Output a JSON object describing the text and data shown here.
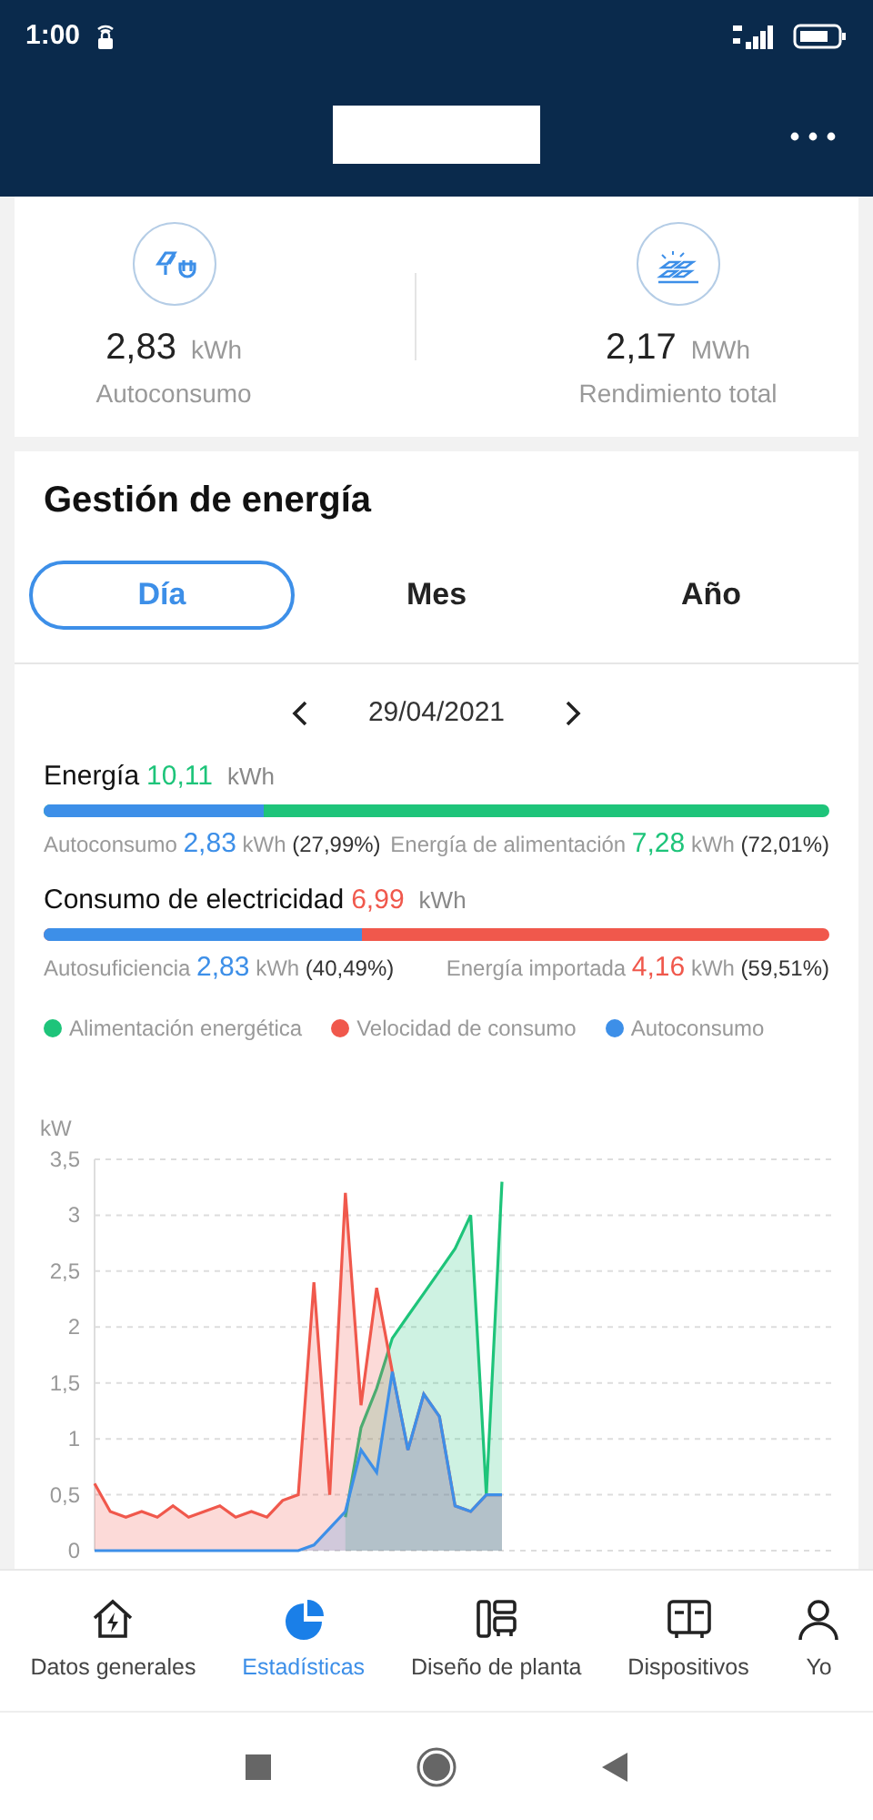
{
  "status_bar": {
    "time": "1:00"
  },
  "summary": [
    {
      "value": "2,83",
      "unit": "kWh",
      "label": "Autoconsumo",
      "kind": "selfuse"
    },
    {
      "value": "2,17",
      "unit": "MWh",
      "label": "Rendimiento total",
      "kind": "yield"
    }
  ],
  "energy_management": {
    "title": "Gestión de energía",
    "tabs": [
      {
        "label": "Día",
        "selected": true
      },
      {
        "label": "Mes",
        "selected": false
      },
      {
        "label": "Año",
        "selected": false
      }
    ],
    "date": "29/04/2021",
    "meters": [
      {
        "title": "Energía",
        "total": "10,11",
        "unit": "kWh",
        "color": "#1ec47a",
        "level": 0.2799,
        "left": {
          "label": "Autoconsumo",
          "value": "2,83",
          "unit": "kWh",
          "percent": "(27,99%)",
          "color": "#3d8fe8"
        },
        "right": {
          "label": "Energía de alimentación",
          "value": "7,28",
          "unit": "kWh",
          "percent": "(72,01%)",
          "color": "#1ec47a"
        }
      },
      {
        "title": "Consumo de electricidad",
        "total": "6,99",
        "unit": "kWh",
        "color": "#f0584c",
        "level": 0.4049,
        "left": {
          "label": "Autosuficiencia",
          "value": "2,83",
          "unit": "kWh",
          "percent": "(40,49%)",
          "color": "#3d8fe8"
        },
        "right": {
          "label": "Energía importada",
          "value": "4,16",
          "unit": "kWh",
          "percent": "(59,51%)",
          "color": "#f0584c"
        }
      }
    ],
    "chart_data": {
      "type": "area",
      "ylabel": "kW",
      "grid": true,
      "ylim": [
        0,
        3.5
      ],
      "yticks": [
        {
          "value": 0,
          "label": "0"
        },
        {
          "value": 0.5,
          "label": "0,5"
        },
        {
          "value": 1,
          "label": "1"
        },
        {
          "value": 1.5,
          "label": "1,5"
        },
        {
          "value": 2,
          "label": "2"
        },
        {
          "value": 2.5,
          "label": "2,5"
        },
        {
          "value": 3,
          "label": "3"
        },
        {
          "value": 3.5,
          "label": "3,5"
        }
      ],
      "series": [
        {
          "name": "Alimentación energética",
          "color": "#1ec47a",
          "values": [
            null,
            null,
            null,
            null,
            null,
            null,
            null,
            null,
            null,
            null,
            null,
            null,
            null,
            null,
            null,
            null,
            0.3,
            1.1,
            1.45,
            1.9,
            2.1,
            2.3,
            2.5,
            2.7,
            3.0,
            0.5,
            3.3,
            null,
            null,
            null,
            null,
            null,
            null,
            null,
            null,
            null,
            null,
            null,
            null,
            null,
            null,
            null,
            null,
            null,
            null,
            null,
            null,
            null
          ]
        },
        {
          "name": "Velocidad de consumo",
          "color": "#f0584c",
          "values": [
            0.6,
            0.35,
            0.3,
            0.35,
            0.3,
            0.4,
            0.3,
            0.35,
            0.4,
            0.3,
            0.35,
            0.3,
            0.45,
            0.5,
            2.4,
            0.5,
            3.2,
            1.3,
            2.35,
            1.6,
            0.9,
            1.4,
            1.2,
            0.4,
            0.35,
            0.5,
            0.5,
            null,
            null,
            null,
            null,
            null,
            null,
            null,
            null,
            null,
            null,
            null,
            null,
            null,
            null,
            null,
            null,
            null,
            null,
            null,
            null,
            null
          ]
        },
        {
          "name": "Autoconsumo",
          "color": "#3d8fe8",
          "values": [
            0,
            0,
            0,
            0,
            0,
            0,
            0,
            0,
            0,
            0,
            0,
            0,
            0,
            0,
            0.05,
            0.2,
            0.35,
            0.9,
            0.7,
            1.6,
            0.9,
            1.4,
            1.2,
            0.4,
            0.35,
            0.5,
            0.5,
            null,
            null,
            null,
            null,
            null,
            null,
            null,
            null,
            null,
            null,
            null,
            null,
            null,
            null,
            null,
            null,
            null,
            null,
            null,
            null,
            null
          ]
        }
      ]
    }
  },
  "bottom_nav": [
    {
      "label": "Datos generales",
      "kind": "home",
      "selected": false
    },
    {
      "label": "Estadísticas",
      "kind": "stats",
      "selected": true
    },
    {
      "label": "Diseño de planta",
      "kind": "layout",
      "selected": false
    },
    {
      "label": "Dispositivos",
      "kind": "devices",
      "selected": false
    },
    {
      "label": "Yo",
      "kind": "me",
      "selected": false
    }
  ]
}
